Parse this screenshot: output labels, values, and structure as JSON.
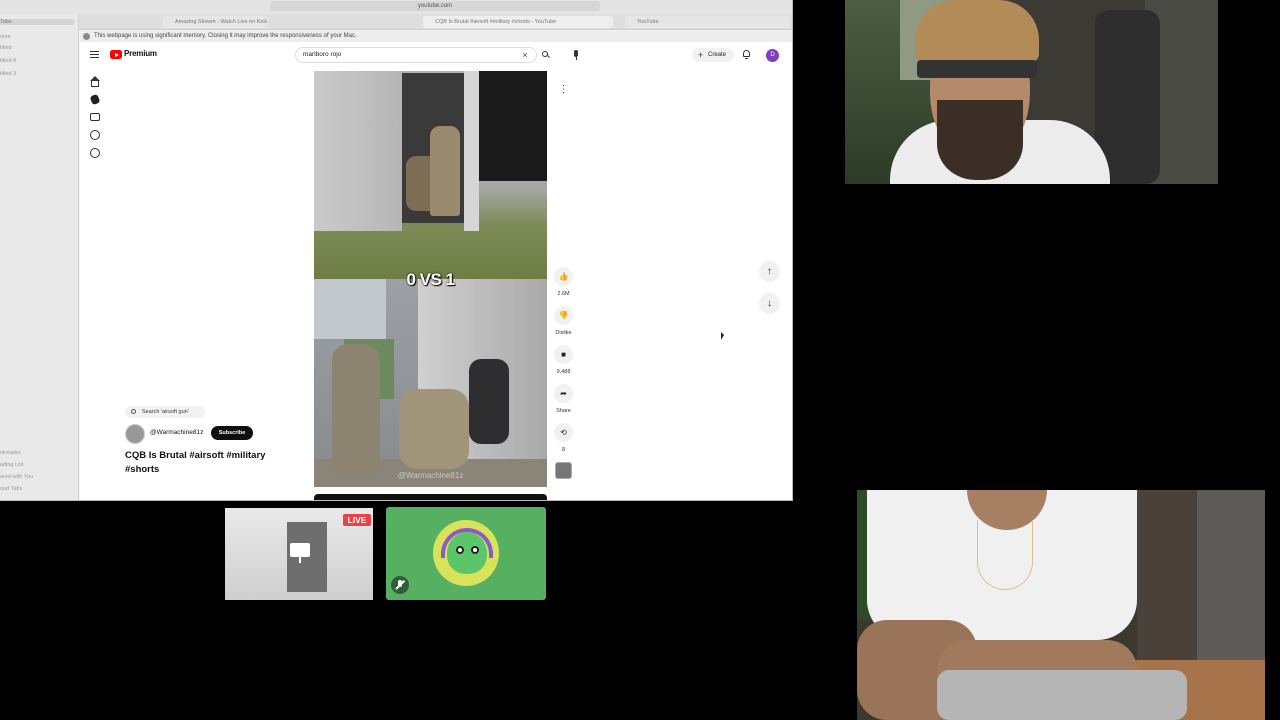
{
  "browser": {
    "url": "youtube.com",
    "tabs": [
      "Amazing Stream - Watch Live on Kick",
      "CQB Is Brutal #airsoft #military #shorts - YouTube",
      "YouTube"
    ],
    "memory_warning": "This webpage is using significant memory. Closing it may improve the responsiveness of your Mac.",
    "sidebar_top": [
      "Tabs",
      "ome",
      "titled",
      "titled 8",
      "titled 3"
    ],
    "sidebar_bottom": [
      "okmarks",
      "ading List",
      "ared with You",
      "oud Tabs"
    ]
  },
  "youtube": {
    "brand": "Premium",
    "search_value": "marlboro rojo",
    "create_label": "Create",
    "avatar_letter": "D",
    "video": {
      "caption": "0 VS 1",
      "watermark": "@Warmachine81z",
      "search_chip": "Search 'airsoft gun'",
      "channel": "@Warmachine81z",
      "subscribe_label": "Subscribe",
      "title": "CQB Is Brutal #airsoft #military #shorts"
    },
    "actions": {
      "likes": "2.6M",
      "dislike_label": "Dislike",
      "comments": "9,488",
      "share_label": "Share",
      "remix_count": "8"
    }
  },
  "stream": {
    "live_badge": "LIVE"
  },
  "icons": {
    "like": "thumbs-up-icon",
    "dislike": "thumbs-down-icon",
    "comment": "comment-icon",
    "share": "share-icon",
    "remix": "remix-icon",
    "nav_up": "arrow-up-icon",
    "nav_down": "arrow-down-icon",
    "mute": "muted-mic-icon"
  },
  "colors": {
    "youtube_red": "#ff0000",
    "live_red": "#ed4245",
    "discord_green": "#57b061",
    "avatar_purple": "#7b3fbf"
  }
}
